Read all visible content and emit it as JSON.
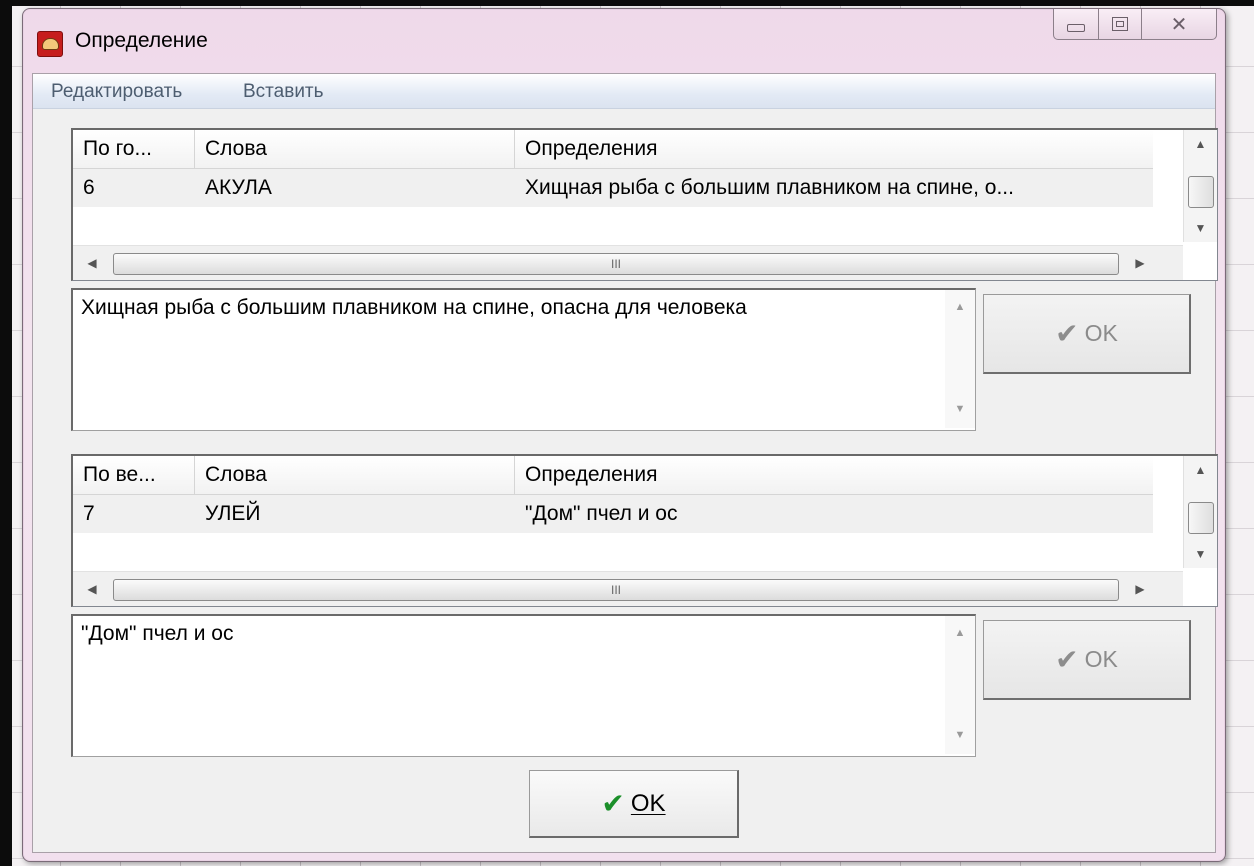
{
  "window": {
    "title": "Определение"
  },
  "menu": {
    "items": [
      "Редактировать",
      "Вставить"
    ]
  },
  "grid1": {
    "columns": [
      "По го...",
      "Слова",
      "Определения"
    ],
    "row": {
      "num": "6",
      "word": "АКУЛА",
      "definition": "Хищная рыба с большим плавником на спине, о..."
    },
    "scroll_grip": "III"
  },
  "memo1": {
    "text": "Хищная рыба с большим плавником на спине, опасна для человека"
  },
  "ok1": {
    "label": "OK"
  },
  "grid2": {
    "columns": [
      "По ве...",
      "Слова",
      "Определения"
    ],
    "row": {
      "num": "7",
      "word": "УЛЕЙ",
      "definition": "\"Дом\" пчел и ос"
    },
    "scroll_grip": "III"
  },
  "memo2": {
    "text": "\"Дом\" пчел и ос"
  },
  "ok2": {
    "label": "OK"
  },
  "main_ok": {
    "label": "OK"
  },
  "colors": {
    "titlebar": "#efd9ea",
    "check_green": "#1b8f2a",
    "check_gray": "#8d8d8d"
  }
}
